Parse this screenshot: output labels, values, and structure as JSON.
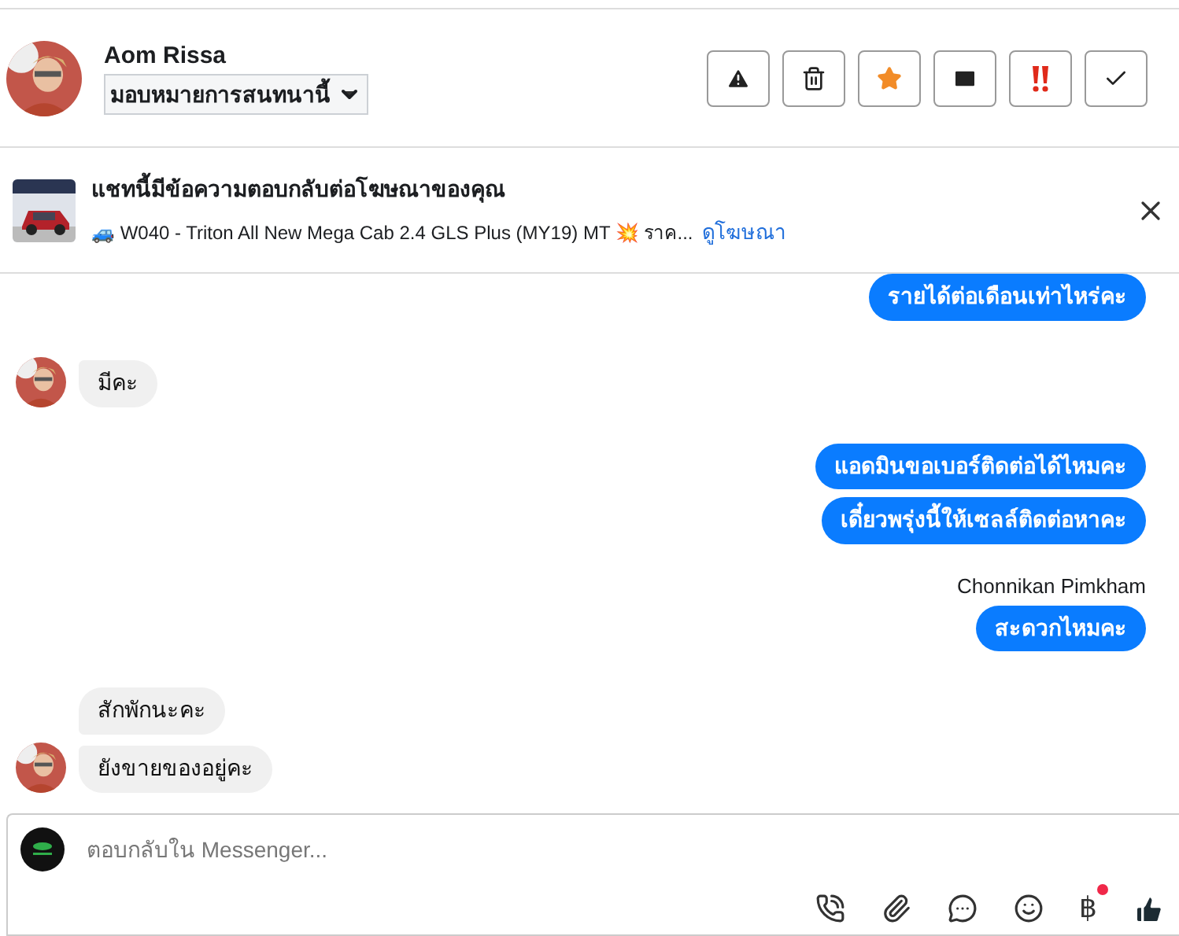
{
  "contact": {
    "name": "Aom Rissa",
    "assign": "มอบหมายการสนทนานี้"
  },
  "actions": [
    {
      "kind": "spam"
    },
    {
      "kind": "delete"
    },
    {
      "kind": "star"
    },
    {
      "kind": "unread"
    },
    {
      "kind": "important"
    },
    {
      "kind": "done"
    }
  ],
  "ad": {
    "title": "แชทนี้มีข้อความตอบกลับต่อโฆษณาของคุณ",
    "detail": "🚙 W040 - Triton All New Mega Cab 2.4 GLS Plus (MY19) MT 💥 ราค...",
    "link": "ดูโฆษณา"
  },
  "messages": [
    {
      "kind": "outgoing",
      "text": "รายได้ต่อเดือนเท่าไหร่คะ"
    },
    {
      "kind": "incoming",
      "text": "มีคะ",
      "avatar": true
    },
    {
      "kind": "outgoing",
      "text": "แอดมินขอเบอร์ติดต่อได้ไหมคะ"
    },
    {
      "kind": "outgoing",
      "text": "เดี๋ยวพรุ่งนี้ให้เซลล์ติดต่อหาคะ"
    },
    {
      "kind": "sender",
      "text": "Chonnikan Pimkham"
    },
    {
      "kind": "outgoing",
      "text": "สะดวกไหมคะ"
    },
    {
      "kind": "incoming",
      "text": "สักพักนะคะ",
      "avatar": false
    },
    {
      "kind": "incoming",
      "text": "ยังขายของอยู่คะ",
      "avatar": true
    }
  ],
  "composer": {
    "placeholder": "ตอบกลับใน Messenger...",
    "tools": [
      {
        "kind": "call"
      },
      {
        "kind": "attach"
      },
      {
        "kind": "reply"
      },
      {
        "kind": "emoji"
      },
      {
        "kind": "baht",
        "text": "฿",
        "badge": true
      },
      {
        "kind": "like"
      }
    ]
  }
}
